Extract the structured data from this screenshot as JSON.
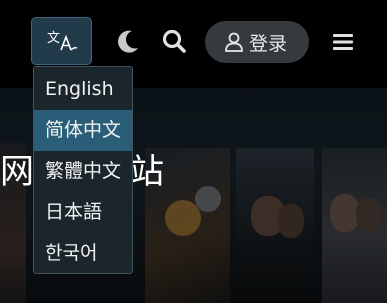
{
  "header": {
    "login_label": "登录",
    "icons": {
      "language": "translate-icon",
      "theme": "moon-icon",
      "search": "search-icon",
      "user": "user-icon",
      "menu": "menu-icon"
    }
  },
  "language_menu": {
    "items": [
      {
        "label": "English",
        "active": false
      },
      {
        "label": "简体中文",
        "active": true
      },
      {
        "label": "繁體中文",
        "active": false
      },
      {
        "label": "日本語",
        "active": false
      },
      {
        "label": "한국어",
        "active": false
      }
    ]
  },
  "page": {
    "site_title_partial": "网",
    "site_title_partial_end": "站"
  },
  "colors": {
    "accent": "#2a5d78",
    "lang_button_bg": "#223b4a",
    "menu_bg": "#1b252c",
    "login_bg": "#353a3f"
  }
}
